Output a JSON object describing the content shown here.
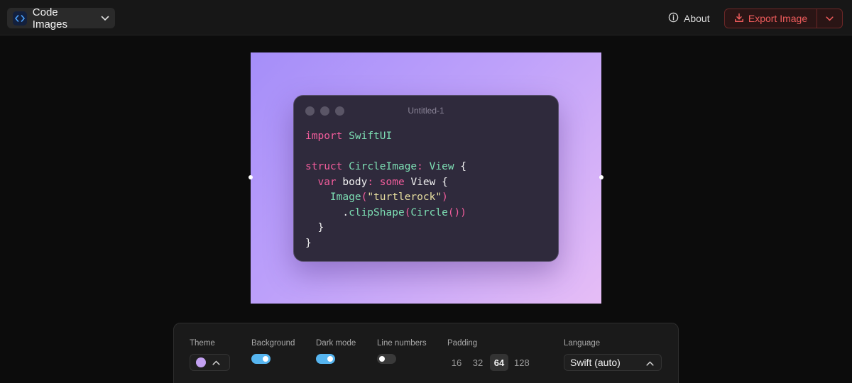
{
  "app": {
    "title": "Code Images"
  },
  "header": {
    "about_label": "About",
    "export_label": "Export Image"
  },
  "window": {
    "title": "Untitled-1"
  },
  "code": {
    "lines": [
      [
        {
          "t": "import",
          "c": "kw"
        },
        {
          "t": " ",
          "c": "pl"
        },
        {
          "t": "SwiftUI",
          "c": "ty"
        }
      ],
      [],
      [
        {
          "t": "struct",
          "c": "kw"
        },
        {
          "t": " ",
          "c": "pl"
        },
        {
          "t": "CircleImage",
          "c": "ty"
        },
        {
          "t": ":",
          "c": "pn"
        },
        {
          "t": " ",
          "c": "pl"
        },
        {
          "t": "View",
          "c": "ty"
        },
        {
          "t": " {",
          "c": "pl"
        }
      ],
      [
        {
          "t": "  ",
          "c": "pl"
        },
        {
          "t": "var",
          "c": "kw"
        },
        {
          "t": " body",
          "c": "pl"
        },
        {
          "t": ":",
          "c": "pn"
        },
        {
          "t": " ",
          "c": "pl"
        },
        {
          "t": "some",
          "c": "kw"
        },
        {
          "t": " View {",
          "c": "pl"
        }
      ],
      [
        {
          "t": "    ",
          "c": "pl"
        },
        {
          "t": "Image",
          "c": "ty"
        },
        {
          "t": "(",
          "c": "pn"
        },
        {
          "t": "\"turtlerock\"",
          "c": "st"
        },
        {
          "t": ")",
          "c": "pn"
        }
      ],
      [
        {
          "t": "      .",
          "c": "pl"
        },
        {
          "t": "clipShape",
          "c": "ty"
        },
        {
          "t": "(",
          "c": "pn"
        },
        {
          "t": "Circle",
          "c": "ty"
        },
        {
          "t": "())",
          "c": "pn"
        }
      ],
      [
        {
          "t": "  }",
          "c": "pl"
        }
      ],
      [
        {
          "t": "}",
          "c": "pl"
        }
      ]
    ]
  },
  "toolbar": {
    "theme_label": "Theme",
    "background_label": "Background",
    "background_on": true,
    "dark_mode_label": "Dark mode",
    "dark_mode_on": true,
    "line_numbers_label": "Line numbers",
    "line_numbers_on": false,
    "padding_label": "Padding",
    "padding_options": [
      "16",
      "32",
      "64",
      "128"
    ],
    "padding_selected": "64",
    "language_label": "Language",
    "language_value": "Swift (auto)"
  },
  "colors": {
    "accent": "#56b5f0",
    "export": "#ef5c5c",
    "theme_swatch": "#c3a1f2",
    "gradient_start": "#a58ef9",
    "gradient_end": "#e6bdf6"
  }
}
